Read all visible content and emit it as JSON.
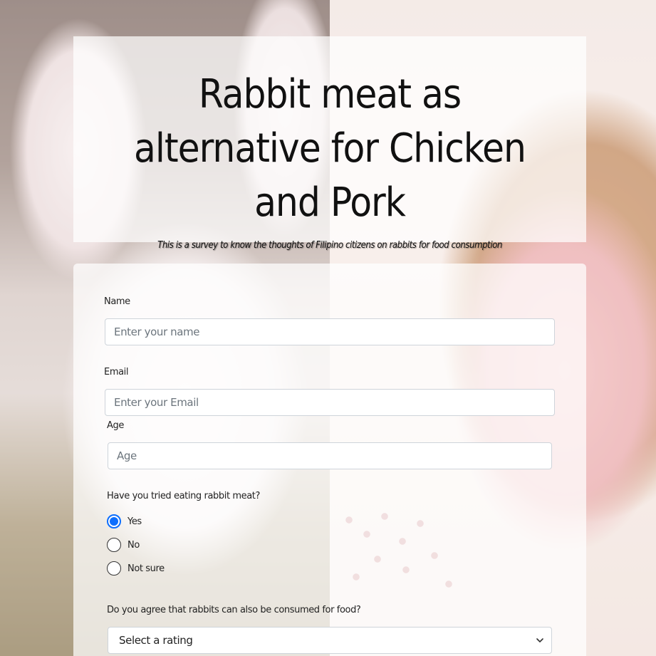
{
  "header": {
    "title": "Rabbit meat as alternative for Chicken and Pork",
    "description": "This is a survey to know the thoughts of Filipino citizens on rabbits for food consumption"
  },
  "form": {
    "name": {
      "label": "Name",
      "placeholder": "Enter your name"
    },
    "email": {
      "label": "Email",
      "placeholder": "Enter your Email"
    },
    "age": {
      "label": "Age",
      "placeholder": "Age"
    },
    "tried_question": {
      "label": "Have you tried eating rabbit meat?",
      "options": [
        {
          "label": "Yes",
          "checked": true
        },
        {
          "label": "No",
          "checked": false
        },
        {
          "label": "Not sure",
          "checked": false
        }
      ]
    },
    "agree_question": {
      "label": "Do you agree that rabbits can also be consumed for food?",
      "selected": "Select a rating"
    }
  },
  "colors": {
    "accent": "#0d6efd",
    "card_background": "rgba(255,255,255,0.72)"
  },
  "icons": [
    "chevron-down-icon"
  ]
}
